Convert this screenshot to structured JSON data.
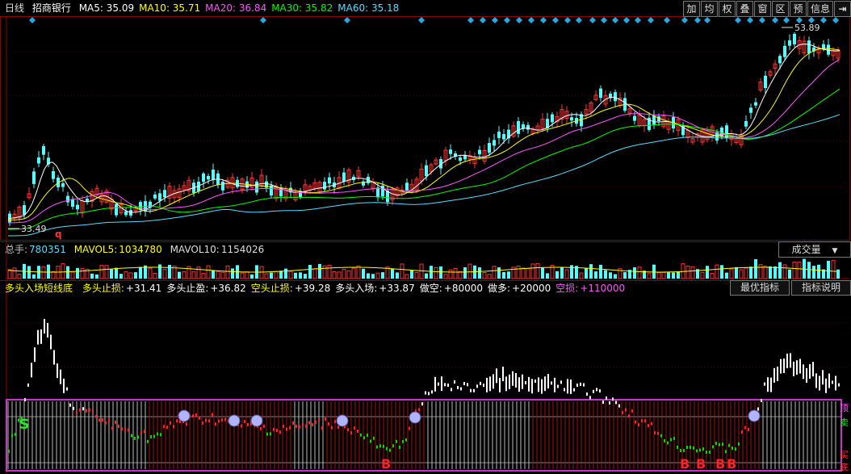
{
  "header": {
    "period": "日线",
    "stock_name": "招商银行",
    "ma": [
      {
        "label": "MA5: 35.09",
        "color": "#ffffff"
      },
      {
        "label": "MA10: 35.71",
        "color": "#ffff00"
      },
      {
        "label": "MA20: 36.84",
        "color": "#ff55ff"
      },
      {
        "label": "MA30: 35.82",
        "color": "#00ff00"
      },
      {
        "label": "MA60: 35.18",
        "color": "#55ddff"
      }
    ]
  },
  "toolbar": {
    "buttons": [
      "加",
      "均",
      "权",
      "叠",
      "窗",
      "区",
      "预",
      "信息"
    ],
    "exit_icon": "exit-icon"
  },
  "price_chart": {
    "high_label": "53.89",
    "low_label": "33.49",
    "marker_q": "q",
    "up_color": "#ff3333",
    "down_color": "#54ffff"
  },
  "volume": {
    "total_label": "总手:",
    "total_value": "780351",
    "mavol5_label": "MAVOL5:",
    "mavol5_value": "1034780",
    "mavol10_label": "MAVOL10:",
    "mavol10_value": "1154026",
    "dropdown": "成交量"
  },
  "indicator": {
    "name": "多头入场短线底",
    "items": [
      {
        "label": "多头止损:",
        "value": "+31.41",
        "label_color": "#ffff00",
        "value_color": "#ffffff"
      },
      {
        "label": "多头止盈:",
        "value": "+36.82",
        "label_color": "#ffffff",
        "value_color": "#ffffff"
      },
      {
        "label": "空头止损:",
        "value": "+39.28",
        "label_color": "#ffff00",
        "value_color": "#ffffff"
      },
      {
        "label": "多头入场:",
        "value": "+33.87",
        "label_color": "#ffffff",
        "value_color": "#ffffff"
      },
      {
        "label": "做空:",
        "value": "+80000",
        "label_color": "#ffffff",
        "value_color": "#ffffff"
      },
      {
        "label": "做多:",
        "value": "+20000",
        "label_color": "#ffffff",
        "value_color": "#ffffff"
      },
      {
        "label": "空损:",
        "value": "+110000",
        "label_color": "#ff55ff",
        "value_color": "#ff55ff"
      }
    ],
    "btn_best": "最优指标",
    "btn_help": "指标说明",
    "side_labels": [
      "顶",
      "卖",
      "买",
      "底"
    ],
    "signal_s": "S",
    "signal_b": "B"
  }
}
